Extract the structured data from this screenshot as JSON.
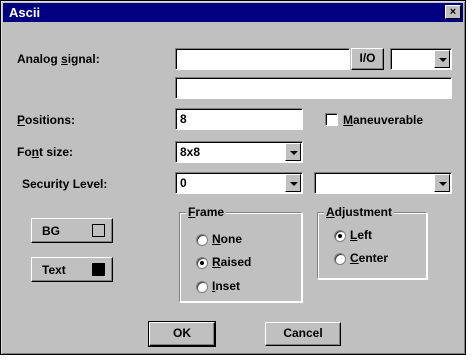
{
  "window": {
    "title": "Ascii",
    "close_glyph": "×"
  },
  "analog_signal": {
    "label_pre": "Analog ",
    "label_u": "s",
    "label_post": "ignal:",
    "value": "",
    "io_button": "I/O",
    "combo_value": "",
    "second_value": ""
  },
  "positions": {
    "label_u": "P",
    "label_post": "ositions:",
    "value": "8"
  },
  "maneuverable": {
    "label_u": "M",
    "label_post": "aneuverable",
    "checked": false
  },
  "font_size": {
    "label_pre": "Fo",
    "label_u": "n",
    "label_post": "t size:",
    "value": "8x8"
  },
  "security_level": {
    "label": "Security Level:",
    "value": "0",
    "second_value": ""
  },
  "colors": {
    "bg_label": "BG",
    "bg_swatch": "#c0c0c0",
    "text_label": "Text",
    "text_swatch": "#000000"
  },
  "frame": {
    "title_u": "F",
    "title_post": "rame",
    "options": [
      {
        "u": "N",
        "post": "one",
        "selected": false
      },
      {
        "u": "R",
        "post": "aised",
        "selected": true
      },
      {
        "u": "I",
        "post": "nset",
        "selected": false
      }
    ]
  },
  "adjustment": {
    "title_u": "A",
    "title_post": "djustment",
    "options": [
      {
        "u": "L",
        "post": "eft",
        "selected": true
      },
      {
        "u": "C",
        "post": "enter",
        "selected": false
      }
    ]
  },
  "buttons": {
    "ok": "OK",
    "cancel": "Cancel"
  }
}
